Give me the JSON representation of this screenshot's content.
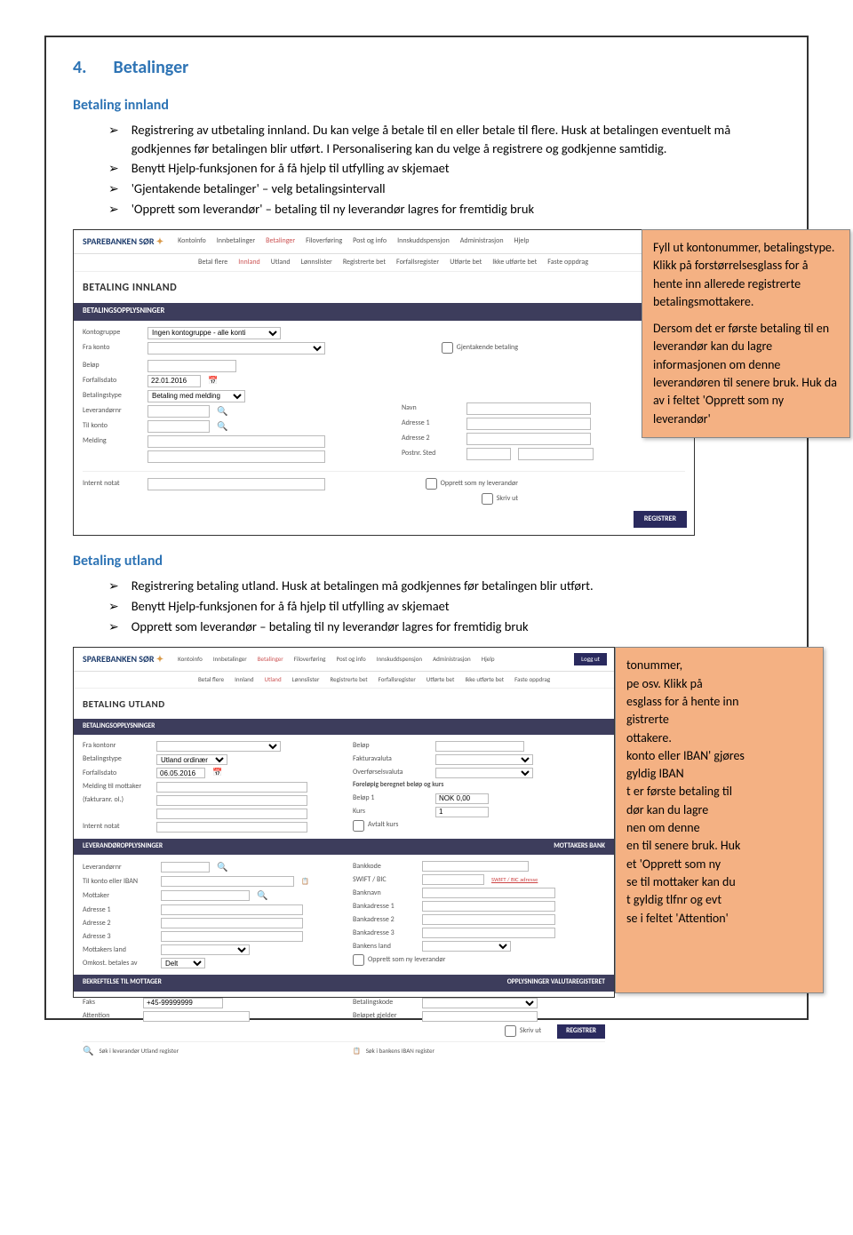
{
  "heading": {
    "num": "4.",
    "title": "Betalinger"
  },
  "section1": {
    "title": "Betaling innland",
    "bullets": [
      "Registrering av utbetaling innland. Du kan velge å betale til en eller betale til flere. Husk at betalingen eventuelt må godkjennes før betalingen blir utført. I Personalisering kan du velge å registrere og godkjenne samtidig.",
      "Benytt Hjelp-funksjonen for å få hjelp til utfylling av skjemaet",
      "'Gjentakende betalinger' – velg betalingsintervall",
      "'Opprett som leverandør' – betaling til ny leverandør lagres for fremtidig bruk"
    ],
    "callout": {
      "p1": "Fyll ut kontonummer, betalingstype. Klikk på forstørrelsesglass for å hente inn allerede registrerte betalingsmottakere.",
      "p2": "Dersom det er første betaling til en leverandør kan du lagre informasjonen om denne leverandøren til senere bruk. Huk da av i feltet 'Opprett som ny leverandør'"
    },
    "ss": {
      "logo": "SPAREBANKEN SØR",
      "tabs": [
        "Kontoinfo",
        "Innbetalinger",
        "Betalinger",
        "Filoverføring",
        "Post og info",
        "Innskuddspensjon",
        "Administrasjon",
        "Hjelp"
      ],
      "subtabs": [
        "Betal flere",
        "Innland",
        "Utland",
        "Lønnslister",
        "Registrerte bet",
        "Forfallsregister",
        "Utførte bet",
        "Ikke utførte bet",
        "Faste oppdrag"
      ],
      "title": "BETALING INNLAND",
      "bar": "BETALINGSOPPLYSNINGER",
      "labels": {
        "kontogruppe": "Kontogruppe",
        "frakonto": "Fra konto",
        "belop": "Beløp",
        "forfall": "Forfallsdato",
        "betalingstype": "Betalingstype",
        "leverandornr": "Leverandørnr",
        "tilkonto": "Til konto",
        "melding": "Melding",
        "internt": "Internt notat",
        "navn": "Navn",
        "adresse1": "Adresse 1",
        "adresse2": "Adresse 2",
        "postnr": "Postnr. Sted",
        "gjentakende": "Gjentakende betaling",
        "opprett": "Opprett som ny leverandør",
        "skriv": "Skriv ut"
      },
      "values": {
        "kontogruppe": "Ingen kontogruppe - alle konti",
        "forfall": "22.01.2016",
        "betalingstype": "Betaling med melding"
      },
      "register": "REGISTRER"
    }
  },
  "section2": {
    "title": "Betaling utland",
    "bullets": [
      "Registrering betaling utland. Husk at betalingen må godkjennes før betalingen blir utført.",
      "Benytt Hjelp-funksjonen for å få hjelp til utfylling av skjemaet",
      "Opprett som leverandør – betaling til ny leverandør lagres for fremtidig bruk"
    ],
    "callout": {
      "p1a": "tonummer,",
      "p1b": "pe osv.  Klikk på",
      "p1c": "esglass for å hente inn",
      "p1d": "gistrerte",
      "p1e": "ottakere.",
      "p2a": "konto eller IBAN' gjøres",
      "p2b": "gyldig IBAN",
      "p3a": "t er første betaling til",
      "p3b": "dør kan du lagre",
      "p3c": "nen om denne",
      "p3d": "en til senere bruk. Huk",
      "p3e": "et 'Opprett som ny",
      "p4a": "se til mottaker kan du",
      "p4b": "t gyldig tlfnr og evt",
      "p4c": "se i feltet 'Attention'"
    },
    "ss": {
      "logo": "SPAREBANKEN SØR",
      "tabs": [
        "Kontoinfo",
        "Innbetalinger",
        "Betalinger",
        "Filoverføring",
        "Post og info",
        "Innskuddspensjon",
        "Administrasjon",
        "Hjelp"
      ],
      "subtabs": [
        "Betal flere",
        "Innland",
        "Utland",
        "Lønnslister",
        "Registrerte bet",
        "Forfallsregister",
        "Utførte bet",
        "Ikke utførte bet",
        "Faste oppdrag"
      ],
      "login": "Logg ut",
      "title": "BETALING UTLAND",
      "bar1": "BETALINGSOPPLYSNINGER",
      "bar2l": "LEVERANDØROPPLYSNINGER",
      "bar2r": "MOTTAKERS BANK",
      "bar3l": "BEKREFTELSE TIL MOTTAGER",
      "bar3r": "OPPLYSNINGER VALUTAREGISTERET",
      "labels": {
        "frakontonr": "Fra kontonr",
        "betalingstype": "Betalingstype",
        "forfall": "Forfallsdato",
        "melding": "Melding til mottaker",
        "fakturanr": "(fakturanr. ol.)",
        "internt": "Internt notat",
        "belop": "Beløp",
        "fakturavaluta": "Fakturavaluta",
        "overforselsvaluta": "Overførselsvaluta",
        "forelopig": "Foreløpig beregnet beløp og kurs",
        "belop1": "Beløp 1",
        "kurs": "Kurs",
        "avtalt": "Avtalt kurs",
        "leverandornr": "Leverandørnr",
        "tilkonto": "Til konto eller IBAN",
        "mottaker": "Mottaker",
        "adresse1": "Adresse 1",
        "adresse2": "Adresse 2",
        "adresse3": "Adresse 3",
        "mottakersland": "Mottakers land",
        "omkost": "Omkost. betales av",
        "bankkode": "Bankkode",
        "swift": "SWIFT / BIC",
        "swiftlink": "SWIFT / BIC adresse",
        "banknavn": "Banknavn",
        "bankadr1": "Bankadresse 1",
        "bankadr2": "Bankadresse 2",
        "bankadr3": "Bankadresse 3",
        "bankensland": "Bankens land",
        "opprett": "Opprett som ny leverandør",
        "faks": "Faks",
        "attention": "Attention",
        "betalingskode": "Betalingskode",
        "belopgjelder": "Beløpet gjelder",
        "skriv": "Skriv ut",
        "sok1": "Søk i leverandør Utland register",
        "sok2": "Søk i bankens IBAN register"
      },
      "values": {
        "betalingstype": "Utland ordinær",
        "forfall": "06.05.2016",
        "belop1": "NOK 0,00",
        "kurs": "1",
        "omkost": "Delt",
        "faks": "+45-99999999"
      },
      "register": "REGISTRER"
    }
  }
}
